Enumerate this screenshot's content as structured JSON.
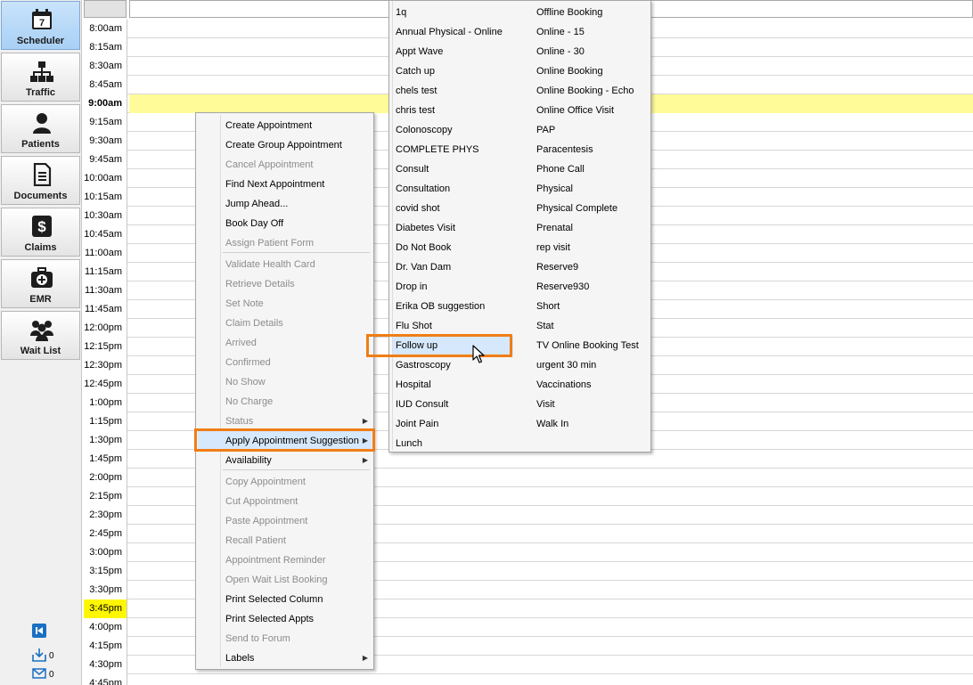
{
  "sidebar": {
    "items": [
      {
        "label": "Scheduler",
        "icon": "calendar-icon",
        "active": true
      },
      {
        "label": "Traffic",
        "icon": "org-chart-icon"
      },
      {
        "label": "Patients",
        "icon": "person-icon"
      },
      {
        "label": "Documents",
        "icon": "document-icon"
      },
      {
        "label": "Claims",
        "icon": "dollar-icon"
      },
      {
        "label": "EMR",
        "icon": "medical-kit-icon"
      },
      {
        "label": "Wait List",
        "icon": "group-icon"
      }
    ],
    "calendar_day": "7",
    "inbox_count": "0",
    "mail_count": "0"
  },
  "schedule": {
    "times": [
      "8:00am",
      "8:15am",
      "8:30am",
      "8:45am",
      "9:00am",
      "9:15am",
      "9:30am",
      "9:45am",
      "10:00am",
      "10:15am",
      "10:30am",
      "10:45am",
      "11:00am",
      "11:15am",
      "11:30am",
      "11:45am",
      "12:00pm",
      "12:15pm",
      "12:30pm",
      "12:45pm",
      "1:00pm",
      "1:15pm",
      "1:30pm",
      "1:45pm",
      "2:00pm",
      "2:15pm",
      "2:30pm",
      "2:45pm",
      "3:00pm",
      "3:15pm",
      "3:30pm",
      "3:45pm",
      "4:00pm",
      "4:15pm",
      "4:30pm",
      "4:45pm"
    ],
    "current_time": "9:00am",
    "marked_time": "3:45pm",
    "highlight_color": "#fffb99",
    "marker_color": "#fff700"
  },
  "context_menu": {
    "items": [
      {
        "label": "Create Appointment",
        "enabled": true
      },
      {
        "label": "Create Group Appointment",
        "enabled": true
      },
      {
        "label": "Cancel Appointment",
        "enabled": false
      },
      {
        "label": "Find Next Appointment",
        "enabled": true
      },
      {
        "label": "Jump Ahead...",
        "enabled": true
      },
      {
        "label": "Book Day Off",
        "enabled": true
      },
      {
        "label": "Assign Patient Form",
        "enabled": false
      },
      {
        "separator": true
      },
      {
        "label": "Validate Health Card",
        "enabled": false
      },
      {
        "label": "Retrieve Details",
        "enabled": false
      },
      {
        "label": "Set Note",
        "enabled": false
      },
      {
        "label": "Claim Details",
        "enabled": false
      },
      {
        "label": "Arrived",
        "enabled": false
      },
      {
        "label": "Confirmed",
        "enabled": false
      },
      {
        "label": "No Show",
        "enabled": false
      },
      {
        "label": "No Charge",
        "enabled": false
      },
      {
        "label": "Status",
        "enabled": false,
        "submenu": true
      },
      {
        "label": "Apply Appointment Suggestion",
        "enabled": true,
        "submenu": true,
        "selected": true
      },
      {
        "label": "Availability",
        "enabled": true,
        "submenu": true
      },
      {
        "separator": true
      },
      {
        "label": "Copy Appointment",
        "enabled": false
      },
      {
        "label": "Cut Appointment",
        "enabled": false
      },
      {
        "label": "Paste Appointment",
        "enabled": false
      },
      {
        "label": "Recall Patient",
        "enabled": false
      },
      {
        "label": "Appointment Reminder",
        "enabled": false
      },
      {
        "label": "Open Wait List Booking",
        "enabled": false
      },
      {
        "label": "Print Selected Column",
        "enabled": true
      },
      {
        "label": "Print Selected Appts",
        "enabled": true
      },
      {
        "label": "Send to Forum",
        "enabled": false
      },
      {
        "label": "Labels",
        "enabled": true,
        "submenu": true
      }
    ]
  },
  "suggestion_menu": {
    "column1": [
      "1q",
      "Annual Physical - Online",
      "Appt Wave",
      "Catch up",
      "chels test",
      "chris test",
      "Colonoscopy",
      "COMPLETE PHYS",
      "Consult",
      "Consultation",
      "covid shot",
      "Diabetes Visit",
      "Do Not Book",
      "Dr. Van Dam",
      "Drop in",
      "Erika OB suggestion",
      "Flu Shot",
      "Follow up",
      "Gastroscopy",
      "Hospital",
      "IUD Consult",
      "Joint Pain",
      "Lunch"
    ],
    "column2": [
      "Offline Booking",
      "Online - 15",
      "Online - 30",
      "Online Booking",
      "Online Booking - Echo",
      "Online Office Visit",
      "PAP",
      "Paracentesis",
      "Phone Call",
      "Physical",
      "Physical Complete",
      "Prenatal",
      "rep visit",
      "Reserve9",
      "Reserve930",
      "Short",
      "Stat",
      "TV Online Booking Test",
      "urgent 30 min",
      "Vaccinations",
      "Visit",
      "Walk In"
    ],
    "selected": "Follow up"
  },
  "theme": {
    "accent": "#f07d16",
    "selection": "#d6e8fb",
    "sidebar_active": "#a9d0f5"
  }
}
